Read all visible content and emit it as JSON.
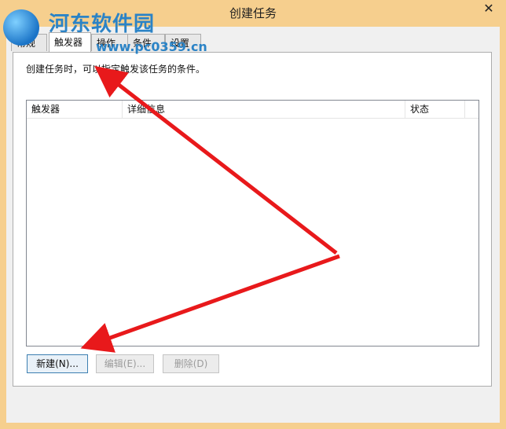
{
  "window": {
    "title": "创建任务",
    "close_symbol": "✕"
  },
  "watermark": {
    "text": "河东软件园",
    "url": "www.pc0359.cn"
  },
  "tabs": [
    {
      "label": "常规"
    },
    {
      "label": "触发器"
    },
    {
      "label": "操作"
    },
    {
      "label": "条件"
    },
    {
      "label": "设置"
    }
  ],
  "triggers_tab": {
    "description": "创建任务时，可以指定触发该任务的条件。",
    "columns": [
      "触发器",
      "详细信息",
      "状态"
    ],
    "rows": []
  },
  "buttons": {
    "new_label": "新建(N)...",
    "edit_label": "编辑(E)...",
    "delete_label": "删除(D)"
  },
  "annotation": {
    "arrow_color": "#e8191b"
  }
}
